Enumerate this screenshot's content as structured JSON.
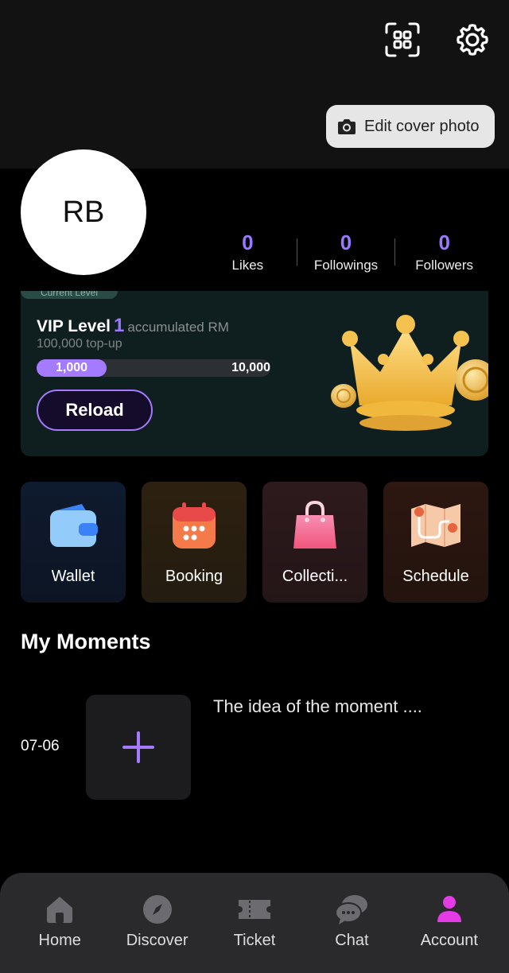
{
  "header": {
    "edit_cover_label": "Edit cover photo"
  },
  "profile": {
    "initials": "RB",
    "stats": [
      {
        "value": "0",
        "label": "Likes"
      },
      {
        "value": "0",
        "label": "Followings"
      },
      {
        "value": "0",
        "label": "Followers"
      }
    ]
  },
  "vip": {
    "tab_label": "Current Level",
    "title": "VIP Level",
    "level": "1",
    "accumulated": "accumulated RM",
    "subtitle": "100,000 top-up",
    "progress_current": "1,000",
    "progress_target": "10,000",
    "progress_fraction": 0.3,
    "reload_label": "Reload"
  },
  "quick_actions": [
    {
      "label": "Wallet",
      "icon": "wallet-icon"
    },
    {
      "label": "Booking",
      "icon": "calendar-icon"
    },
    {
      "label": "Collecti...",
      "icon": "shopping-bag-icon"
    },
    {
      "label": "Schedule",
      "icon": "map-icon"
    }
  ],
  "moments": {
    "title": "My Moments",
    "date": "07-06",
    "placeholder_text": "The idea of the moment ...."
  },
  "tabbar": [
    {
      "label": "Home",
      "icon": "home-icon",
      "active": false
    },
    {
      "label": "Discover",
      "icon": "compass-icon",
      "active": false
    },
    {
      "label": "Ticket",
      "icon": "ticket-icon",
      "active": false
    },
    {
      "label": "Chat",
      "icon": "chat-icon",
      "active": false
    },
    {
      "label": "Account",
      "icon": "person-icon",
      "active": true
    }
  ],
  "colors": {
    "accent": "#9b78ff",
    "active_tab": "#e43be6",
    "inactive_icon": "#6b6b70"
  }
}
